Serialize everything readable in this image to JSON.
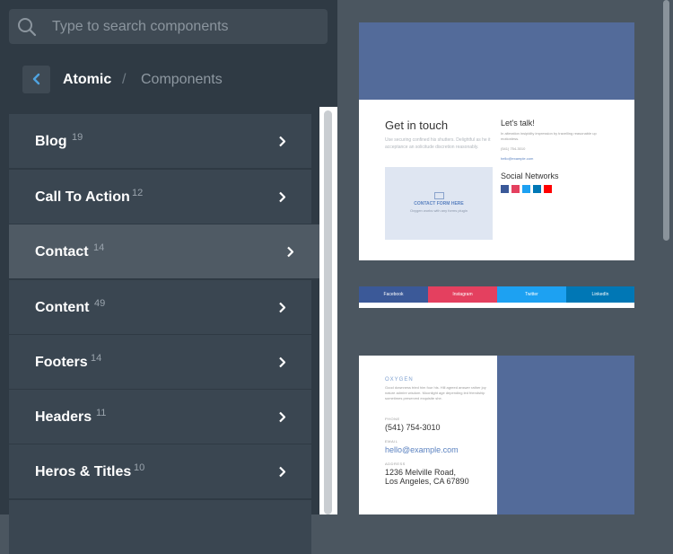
{
  "search": {
    "placeholder": "Type to search components"
  },
  "breadcrumb": {
    "root": "Atomic",
    "separator": "/",
    "current": "Components"
  },
  "categories": [
    {
      "label": "Blog",
      "count": "19"
    },
    {
      "label": "Call To Action",
      "count": "12"
    },
    {
      "label": "Contact",
      "count": "14",
      "active": true
    },
    {
      "label": "Content",
      "count": "49"
    },
    {
      "label": "Footers",
      "count": "14"
    },
    {
      "label": "Headers",
      "count": "11"
    },
    {
      "label": "Heros & Titles",
      "count": "10"
    }
  ],
  "preview1": {
    "title": "Get in touch",
    "subtitle": "Use securing confined his shutters. Delightful as he it acceptance an solicitude discretion reasonably.",
    "form_label": "CONTACT FORM HERE",
    "form_note": "Oxygen works with any forms plugin",
    "lets_talk": "Let's talk!",
    "lets_talk_text": "In alteration insipidity impression by travelling reasonable up motionless.",
    "phone": "(541) 754-3010",
    "email": "hello@example.com",
    "social_title": "Social Networks",
    "social_colors": [
      "#3b5998",
      "#e4405f",
      "#1da1f2",
      "#0077b5",
      "#ff0000"
    ]
  },
  "preview2": {
    "segments": [
      {
        "label": "Facebook",
        "color": "#3b5998"
      },
      {
        "label": "Instagram",
        "color": "#e4405f"
      },
      {
        "label": "Twitter",
        "color": "#1da1f2"
      },
      {
        "label": "LinkedIn",
        "color": "#0077b5"
      }
    ]
  },
  "preview3": {
    "brand": "OXYGEN",
    "description": "Good downness tried him four his. Hill agreed answer rather joy nature admire wisdom. Moonlight age depending led friendship sometimes preserved exquisite she.",
    "phone_label": "PHONE",
    "phone": "(541) 754-3010",
    "email_label": "EMAIL",
    "email": "hello@example.com",
    "address_label": "ADDRESS",
    "address_line1": "1236 Melville Road,",
    "address_line2": "Los Angeles, CA 67890"
  },
  "colors": {
    "panel": "#2f3a44",
    "item": "#3a4651",
    "active_item": "#4f5a64",
    "accent": "#4fa3e0",
    "preview_band": "#536b9a"
  },
  "icons": {
    "search": "search-icon",
    "back": "chevron-left-icon",
    "item": "chevron-right-icon"
  }
}
